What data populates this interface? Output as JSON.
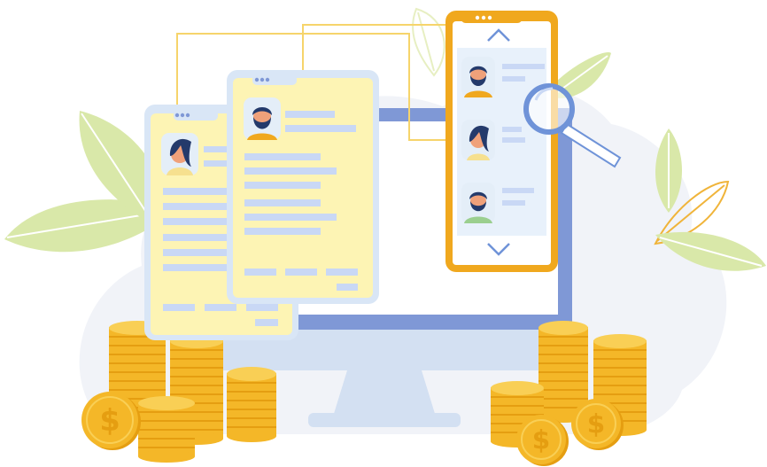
{
  "scene": {
    "description_kind": "illustration",
    "currency_symbol": "$",
    "colors": {
      "background_blob": "#f1f3f8",
      "leaf_green": "#d9e8a9",
      "leaf_vein": "#ffffff",
      "leaf_outline_orange": "#f0b43a",
      "monitor_frame": "#7f98d6",
      "monitor_screen": "#ffffff",
      "monitor_stand": "#d3e0f2",
      "card_fill": "#fdf4b4",
      "card_border": "#d9e6f6",
      "phone_frame": "#f0a81e",
      "phone_list_bg": "#e8f1fb",
      "placeholder_bar": "#c9d8f5",
      "connector_line": "#f6d46b",
      "coin_gold": "#f4b728",
      "coin_shadow": "#e59e11",
      "coin_rim": "#f9cf55",
      "avatar_bg": "#e4eef8",
      "skin": "#f0a17a",
      "hair_dark": "#243a6b",
      "shirt_orange": "#f0a81e",
      "shirt_green": "#9bcf8f",
      "magnifier_blue": "#6f93d8"
    },
    "icons": [
      "chevron-up-icon",
      "chevron-down-icon",
      "magnifier-icon",
      "dollar-coin-icon",
      "avatar-icon"
    ]
  }
}
